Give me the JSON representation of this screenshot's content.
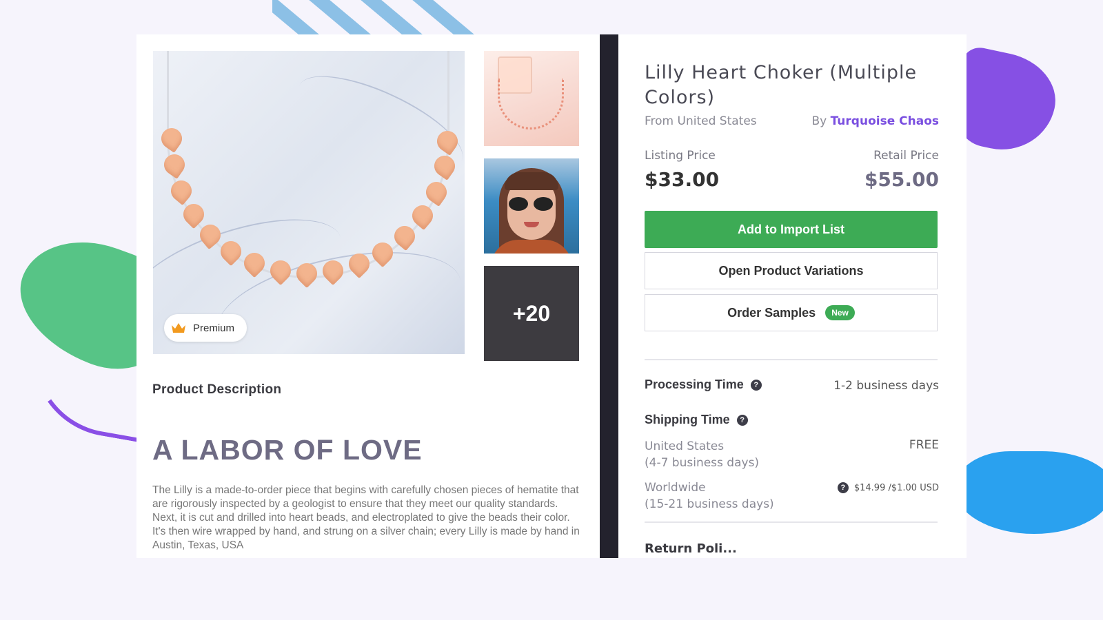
{
  "product": {
    "title": "Lilly Heart Choker (Multiple Colors)",
    "origin": "From United States",
    "by_prefix": "By",
    "seller": "Turquoise Chaos"
  },
  "gallery": {
    "premium_label": "Premium",
    "more_count": "+20"
  },
  "pricing": {
    "listing_label": "Listing Price",
    "listing_value": "$33.00",
    "retail_label": "Retail Price",
    "retail_value": "$55.00"
  },
  "actions": {
    "add_to_import": "Add to Import List",
    "open_variations": "Open Product Variations",
    "order_samples": "Order Samples",
    "new_badge": "New"
  },
  "shipping": {
    "processing_label": "Processing Time",
    "processing_value": "1-2 business days",
    "shipping_label": "Shipping Time",
    "destinations": [
      {
        "name": "United States",
        "duration": "(4-7 business days)",
        "price": "FREE"
      },
      {
        "name": "Worldwide",
        "duration": "(15-21 business days)",
        "price": "$14.99 /$1.00 USD"
      }
    ],
    "next_section_partial": "Return Poli..."
  },
  "description": {
    "section_label": "Product Description",
    "heading": "A LABOR OF LOVE",
    "body": "The Lilly is a made-to-order piece that begins with carefully chosen pieces of hematite that are rigorously inspected by a geologist to ensure that they meet our quality standards.  Next, it is cut and drilled into heart beads, and electroplated to give the beads their color. It's then wire wrapped by hand, and strung on a silver  chain; every Lilly is made by hand in Austin, Texas, USA"
  },
  "colors": {
    "primary_green": "#3dab55",
    "seller_purple": "#7a4fe0",
    "divider_dark": "#23222d",
    "heading_muted": "#6e6b84"
  },
  "icons": [
    "crown-icon",
    "help-icon"
  ]
}
